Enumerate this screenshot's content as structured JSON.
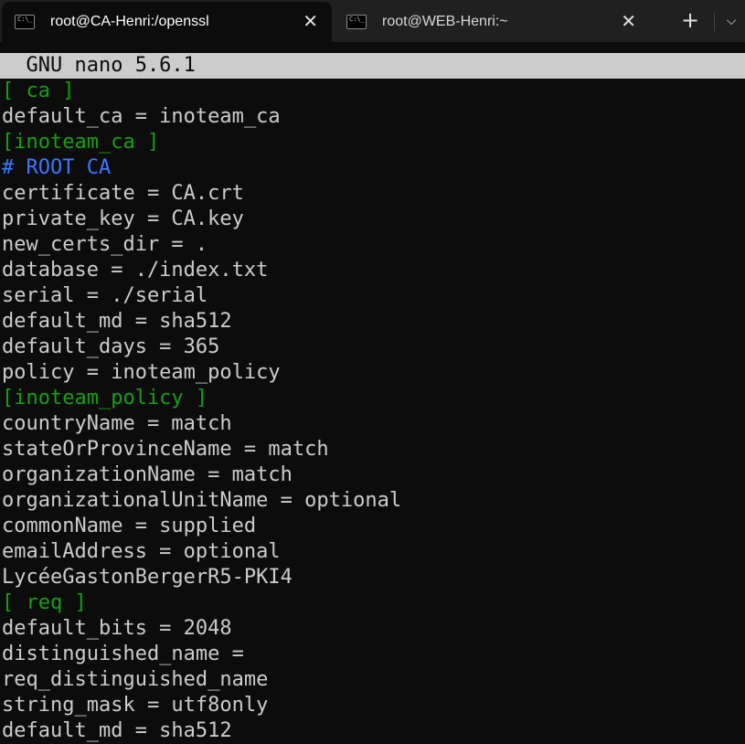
{
  "tabs": [
    {
      "title": "root@CA-Henri:/openssl",
      "active": true,
      "icon": "terminal-icon"
    },
    {
      "title": "root@WEB-Henri:~",
      "active": false,
      "icon": "terminal-icon"
    }
  ],
  "tab_icon_text": "C:\\_",
  "close_glyph": "✕",
  "new_tab_glyph": "+",
  "dropdown_glyph": "⌵",
  "editor": {
    "title": "  GNU nano 5.6.1",
    "lines": [
      {
        "text": "[ ca ]",
        "kind": "section"
      },
      {
        "text": "default_ca = inoteam_ca",
        "kind": "plain"
      },
      {
        "text": "[inoteam_ca ]",
        "kind": "section"
      },
      {
        "text": "# ROOT CA",
        "kind": "comment"
      },
      {
        "text": "certificate = CA.crt",
        "kind": "plain"
      },
      {
        "text": "private_key = CA.key",
        "kind": "plain"
      },
      {
        "text": "new_certs_dir = .",
        "kind": "plain"
      },
      {
        "text": "database = ./index.txt",
        "kind": "plain"
      },
      {
        "text": "serial = ./serial",
        "kind": "plain"
      },
      {
        "text": "default_md = sha512",
        "kind": "plain"
      },
      {
        "text": "default_days = 365",
        "kind": "plain"
      },
      {
        "text": "policy = inoteam_policy",
        "kind": "plain"
      },
      {
        "text": "[inoteam_policy ]",
        "kind": "section"
      },
      {
        "text": "countryName = match",
        "kind": "plain"
      },
      {
        "text": "stateOrProvinceName = match",
        "kind": "plain"
      },
      {
        "text": "organizationName = match",
        "kind": "plain"
      },
      {
        "text": "organizationalUnitName = optional",
        "kind": "plain"
      },
      {
        "text": "commonName = supplied",
        "kind": "plain"
      },
      {
        "text": "emailAddress = optional",
        "kind": "plain"
      },
      {
        "text": "LycéeGastonBergerR5-PKI4",
        "kind": "plain"
      },
      {
        "text": "[ req ]",
        "kind": "section"
      },
      {
        "text": "default_bits = 2048",
        "kind": "plain"
      },
      {
        "text": "distinguished_name =",
        "kind": "plain"
      },
      {
        "text": "req_distinguished_name",
        "kind": "plain"
      },
      {
        "text": "string_mask = utf8only",
        "kind": "plain"
      },
      {
        "text": "default_md = sha512",
        "kind": "plain"
      }
    ]
  },
  "colors": {
    "background": "#0c0c0c",
    "text": "#cccccc",
    "section": "#13a10e",
    "comment": "#3b78ff",
    "titlebar": "#cccccc"
  }
}
